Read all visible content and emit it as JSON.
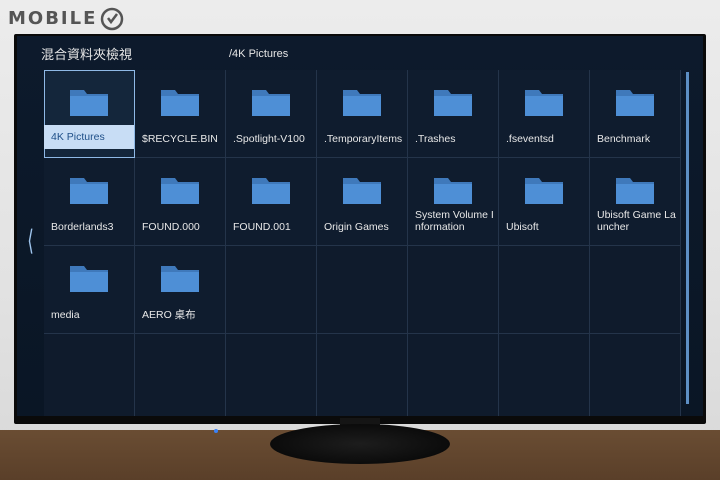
{
  "watermark": {
    "text": "MOBILE"
  },
  "header": {
    "title": "混合資料夾檢視",
    "path": "/4K Pictures"
  },
  "folders": [
    {
      "label": "4K Pictures",
      "selected": true
    },
    {
      "label": "$RECYCLE.BIN"
    },
    {
      "label": ".Spotlight-V100"
    },
    {
      "label": ".TemporaryItems"
    },
    {
      "label": ".Trashes"
    },
    {
      "label": ".fseventsd"
    },
    {
      "label": "Benchmark"
    },
    {
      "label": "Borderlands3"
    },
    {
      "label": "FOUND.000"
    },
    {
      "label": "FOUND.001"
    },
    {
      "label": "Origin Games"
    },
    {
      "label": "System Volume Information"
    },
    {
      "label": "Ubisoft"
    },
    {
      "label": "Ubisoft Game Launcher"
    },
    {
      "label": "media"
    },
    {
      "label": "AERO 桌布"
    }
  ],
  "colors": {
    "folder": "#4e8fd6",
    "folder_dark": "#3f79bb",
    "screen_bg": "#0d1a2c",
    "selected_label_bg": "#c8ddf5"
  },
  "icons": {
    "folder": "folder-icon",
    "nav_left": "chevron-left-icon"
  }
}
